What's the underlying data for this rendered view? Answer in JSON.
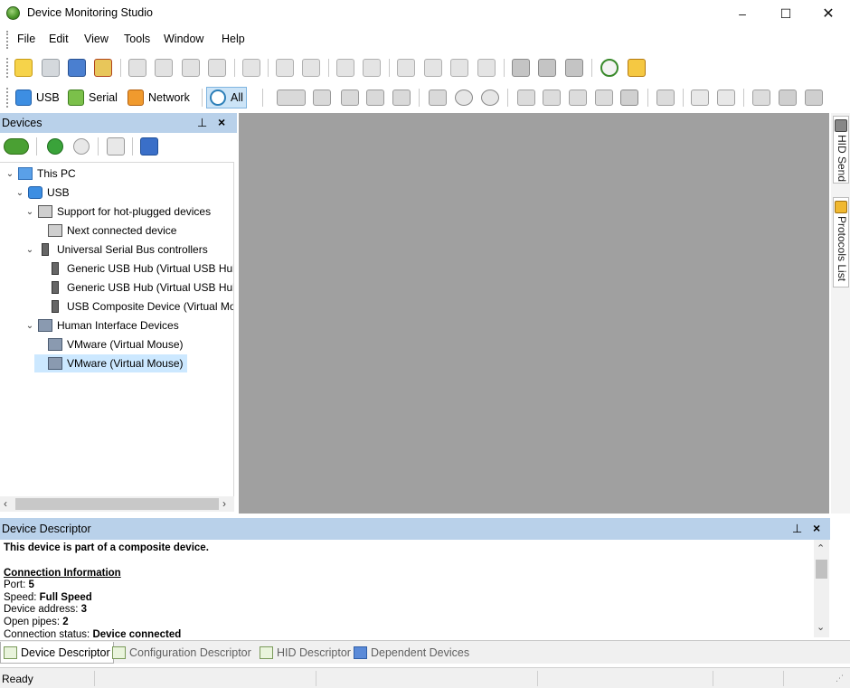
{
  "app": {
    "title": "Device Monitoring Studio"
  },
  "window_controls": {
    "minimize": "–",
    "maximize": "☐",
    "close": "✕"
  },
  "menu": [
    "File",
    "Edit",
    "View",
    "Tools",
    "Window",
    "Help"
  ],
  "connection_tabs": [
    {
      "label": "USB",
      "icon": "usb-icon"
    },
    {
      "label": "Serial",
      "icon": "serial-icon"
    },
    {
      "label": "Network",
      "icon": "network-icon"
    },
    {
      "label": "All",
      "icon": "all-icon"
    }
  ],
  "devices_panel": {
    "title": "Devices",
    "pin": "1",
    "close": "×",
    "tree": [
      {
        "label": "This PC",
        "icon": "computer-icon",
        "level": 0,
        "expanded": true
      },
      {
        "label": "USB",
        "icon": "usb-icon",
        "level": 1,
        "expanded": true
      },
      {
        "label": "Support for hot-plugged devices",
        "icon": "hotplug-icon",
        "level": 2,
        "expanded": true
      },
      {
        "label": "Next connected device",
        "icon": "hotplug-icon",
        "level": 3
      },
      {
        "label": "Universal Serial Bus controllers",
        "icon": "usb-plug-icon",
        "level": 2,
        "expanded": true
      },
      {
        "label": "Generic USB Hub (Virtual USB Hub)",
        "icon": "usb-plug-icon",
        "level": 3
      },
      {
        "label": "Generic USB Hub (Virtual USB Hub)",
        "icon": "usb-plug-icon",
        "level": 3
      },
      {
        "label": "USB Composite Device (Virtual Mouse)",
        "icon": "usb-plug-icon",
        "level": 3
      },
      {
        "label": "Human Interface Devices",
        "icon": "keyboard-icon",
        "level": 2,
        "expanded": true
      },
      {
        "label": "VMware (Virtual Mouse)",
        "icon": "keyboard-icon",
        "level": 3
      },
      {
        "label": "VMware (Virtual Mouse)",
        "icon": "keyboard-icon",
        "level": 3,
        "selected": true
      }
    ]
  },
  "side_tabs": [
    "HID Send",
    "Protocols List"
  ],
  "descriptor_pane": {
    "title": "Device Descriptor",
    "composite_note": "This device is part of a composite device.",
    "section_title": "Connection Information",
    "fields": [
      {
        "label": "Port: ",
        "value": "5"
      },
      {
        "label": "Speed: ",
        "value": "Full Speed"
      },
      {
        "label": "Device address: ",
        "value": "3"
      },
      {
        "label": "Open pipes: ",
        "value": "2"
      },
      {
        "label": "Connection status: ",
        "value": "Device connected"
      }
    ]
  },
  "bottom_tabs": [
    {
      "label": "Device Descriptor",
      "active": true
    },
    {
      "label": "Configuration Descriptor",
      "active": false
    },
    {
      "label": "HID Descriptor",
      "active": false
    },
    {
      "label": "Dependent Devices",
      "active": false
    }
  ],
  "status": {
    "text": "Ready"
  },
  "colors": {
    "panel_header": "#b9d1ea",
    "workspace": "#a0a0a0",
    "selection": "#cce8ff"
  }
}
